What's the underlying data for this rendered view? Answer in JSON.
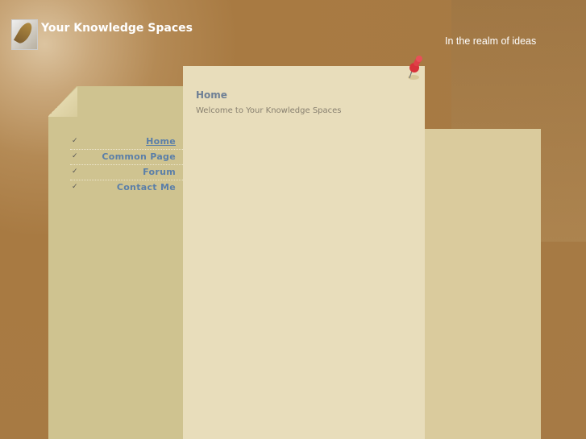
{
  "header": {
    "site_title": "Your Knowledge Spaces",
    "tagline": "In the realm of ideas",
    "logo_icon": "quill-logo-icon"
  },
  "nav": {
    "items": [
      {
        "label": "Home",
        "active": true
      },
      {
        "label": "Common Page",
        "active": false
      },
      {
        "label": "Forum",
        "active": false
      },
      {
        "label": "Contact Me",
        "active": false
      }
    ],
    "check_glyph": "✓"
  },
  "content": {
    "heading": "Home",
    "text": "Welcome to Your Knowledge Spaces"
  },
  "colors": {
    "background": "#a87a42",
    "left_panel": "#cfc390",
    "center_panel": "#e8ddbb",
    "right_panel": "#dacb9d",
    "link": "#5b7fa8",
    "pin": "#d8323a"
  }
}
